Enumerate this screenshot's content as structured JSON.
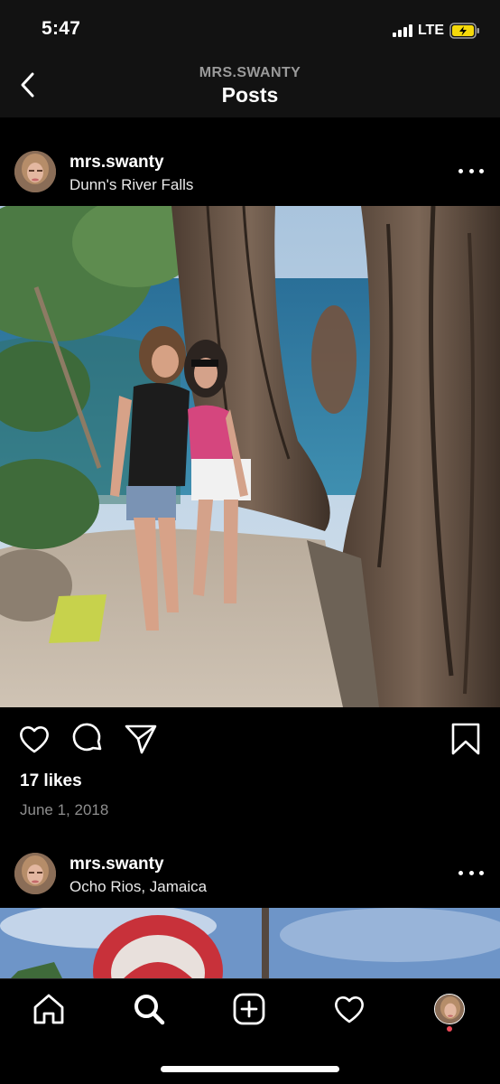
{
  "status": {
    "time": "5:47",
    "network": "LTE",
    "battery_color": "#f5d90a"
  },
  "header": {
    "username": "MRS.SWANTY",
    "title": "Posts"
  },
  "posts": [
    {
      "username": "mrs.swanty",
      "location": "Dunn's River Falls",
      "likes": "17 likes",
      "date": "June 1, 2018"
    },
    {
      "username": "mrs.swanty",
      "location": "Ocho Rios, Jamaica"
    }
  ],
  "icons": {
    "back": "chevron-left-icon",
    "more": "more-horizontal-icon",
    "like": "heart-icon",
    "comment": "comment-icon",
    "share": "paper-plane-icon",
    "save": "bookmark-icon",
    "home": "home-icon",
    "search": "search-icon",
    "new_post": "plus-square-icon",
    "activity": "heart-icon",
    "profile": "avatar"
  },
  "colors": {
    "background": "#000000",
    "bar": "#121212",
    "secondary_text": "#8e8e8e",
    "notification": "#ed4956"
  }
}
